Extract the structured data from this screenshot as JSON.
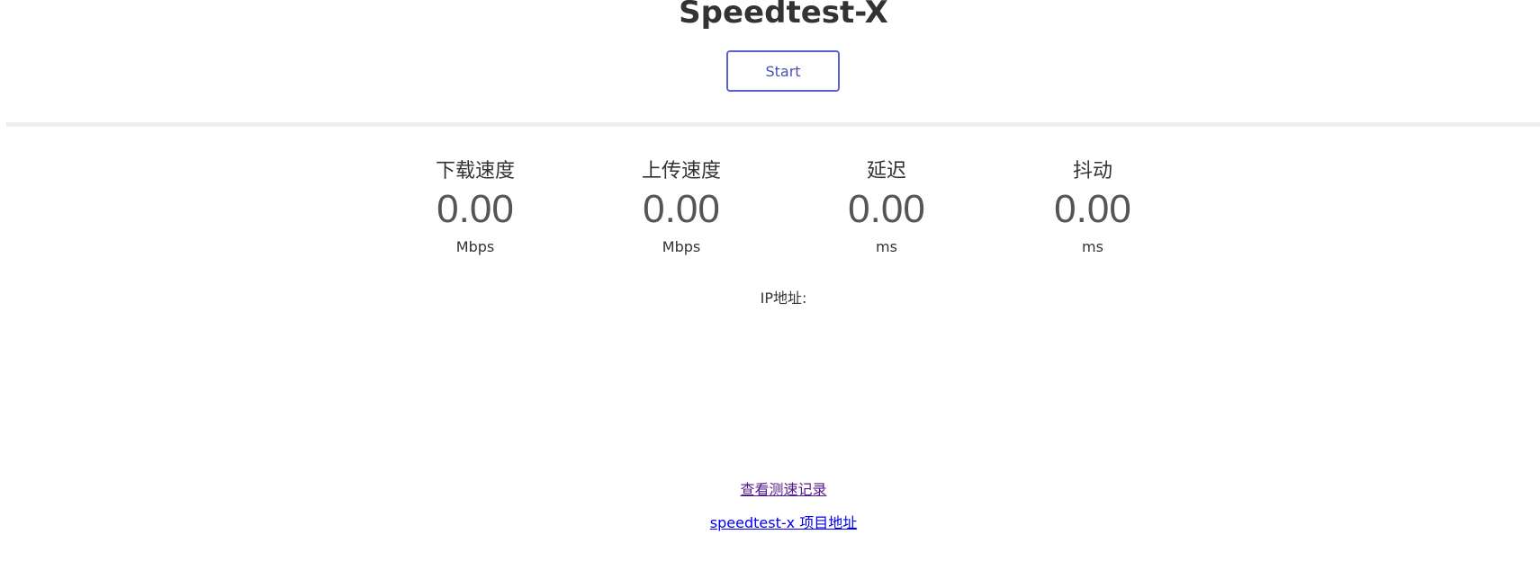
{
  "header": {
    "title": "Speedtest-X",
    "start_label": "Start"
  },
  "metrics": [
    {
      "label": "下载速度",
      "value": "0.00",
      "unit": "Mbps"
    },
    {
      "label": "上传速度",
      "value": "0.00",
      "unit": "Mbps"
    },
    {
      "label": "延迟",
      "value": "0.00",
      "unit": "ms"
    },
    {
      "label": "抖动",
      "value": "0.00",
      "unit": "ms"
    }
  ],
  "ip": {
    "label": "IP地址:",
    "value": ""
  },
  "links": {
    "records": "查看测速记录",
    "project": "speedtest-x 项目地址"
  },
  "colors": {
    "accent": "#5b5fd6",
    "divider": "#eeeeee",
    "visited_link": "#551a8b",
    "link": "#0000ee"
  }
}
